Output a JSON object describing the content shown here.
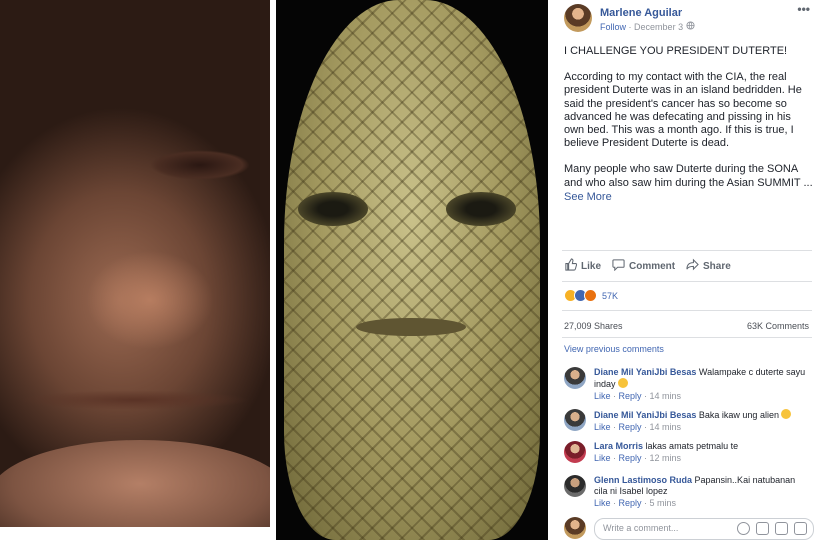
{
  "post": {
    "author": "Marlene Aguilar",
    "follow_label": "Follow",
    "separator": "·",
    "date": "December 3",
    "privacy_icon": "globe-icon",
    "more_label": "•••",
    "paragraphs": [
      "I CHALLENGE YOU PRESIDENT DUTERTE!",
      "According to my contact with the CIA, the real president Duterte was in an island bedridden. He said the president's cancer has so become so advanced he was defecating and pissing in his own bed. This was a month ago. If this is true, I believe President Duterte is dead.",
      "Many people who saw Duterte during the SONA and who also saw him during the Asian SUMMIT ..."
    ],
    "see_more": "See More"
  },
  "actions": {
    "like": "Like",
    "comment": "Comment",
    "share": "Share"
  },
  "stats": {
    "reaction_count": "57K",
    "shares": "27,009 Shares",
    "comments": "63K Comments",
    "view_previous": "View previous comments"
  },
  "comments": [
    {
      "name": "Diane Mil YaniJbi Besas",
      "text": "Walampake c duterte sayu inday",
      "emoji": true,
      "like": "Like",
      "reply": "Reply",
      "time": "14 mins"
    },
    {
      "name": "Diane Mil YaniJbi Besas",
      "text": "Baka ikaw ung alien",
      "emoji": true,
      "like": "Like",
      "reply": "Reply",
      "time": "14 mins"
    },
    {
      "name": "Lara Morris",
      "text": "lakas amats petmalu te",
      "emoji": false,
      "like": "Like",
      "reply": "Reply",
      "time": "12 mins"
    },
    {
      "name": "Glenn Lastimoso Ruda",
      "text": "Papansin..Kai natubanan cila ni Isabel lopez",
      "emoji": false,
      "like": "Like",
      "reply": "Reply",
      "time": "5 mins"
    }
  ],
  "composer": {
    "placeholder": "Write a comment..."
  },
  "colors": {
    "link": "#365899",
    "accent": "#4267b2",
    "muted": "#90949c"
  }
}
